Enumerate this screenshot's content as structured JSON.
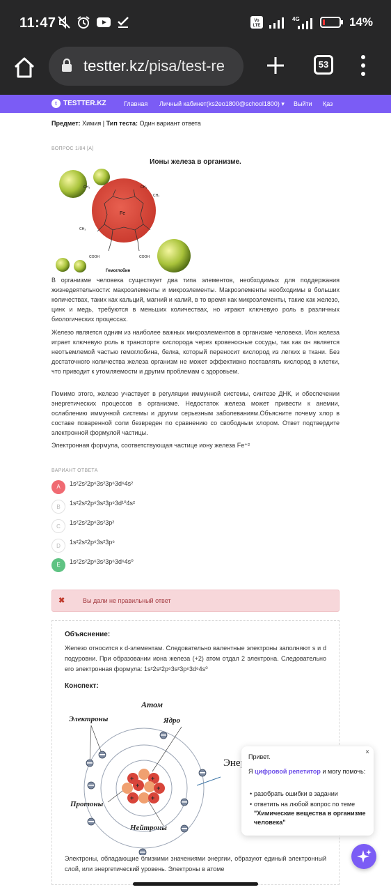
{
  "status_bar": {
    "time": "11:47",
    "battery_percent": "14%",
    "network": "4G",
    "volte": "Vo LTE",
    "icons": [
      "mute-icon",
      "alarm-icon",
      "youtube-icon",
      "check-icon",
      "signal-icon",
      "battery-icon"
    ]
  },
  "browser": {
    "url_host": "testter.kz",
    "url_path": "/pisa/test-re",
    "tab_count": "53"
  },
  "site_nav": {
    "logo": "TESTTER.KZ",
    "logo_badge": "t",
    "items": [
      "Главная",
      "Личный кабинет(ks2eo1800@school1800) ▾",
      "Выйти",
      "Қаз"
    ]
  },
  "meta": {
    "subject_label": "Предмет:",
    "subject_value": "Химия",
    "separator": "|",
    "type_label": "Тип теста:",
    "type_value": "Один вариант ответа"
  },
  "question": {
    "number": "ВОПРОС 1/84 [A]",
    "title": "Ионы железа в организме.",
    "image_caption": "Гемоглобин",
    "paragraphs": [
      "В организме человека существует два типа элементов, необходимых для поддержания жизнедеятельности: макроэлементы и микроэлементы. Макроэлементы необходимы в больших количествах, таких как кальций, магний и калий, в то время как микроэлементы, такие как железо, цинк и медь, требуются в меньших количествах, но играют ключевую роль в различных биологических процессах.",
      "Железо является одним из наиболее важных микроэлементов в организме человека. Ион железа играет ключевую роль в транспорте кислорода через кровеносные сосуды, так как он является неотъемлемой частью гемоглобина, белка, который переносит кислород из легких в ткани. Без достаточного количества железа организм не может эффективно поставлять кислород в клетки, что приводит к утомляемости и другим проблемам с здоровьем.",
      "Помимо этого, железо участвует в регуляции иммунной системы, синтезе ДНК, и обеспечении энергетических процессов в организме. Недостаток железа может привести к анемии, ослаблению иммунной системы и другим серьезным заболеваниям.Объясните почему хлор в составе поваренной соли безвреден по сравнению со свободным хлором. Ответ подтвердите электронной формулой частицы."
    ],
    "prompt": "Электронная формула, соответствующая частице иону железа Fe⁺²"
  },
  "variants": {
    "label": "ВАРИАНТ ОТВЕТА",
    "options": [
      {
        "letter": "A",
        "text": "1s²2s²2p⁶3s²3p⁶3d⁶4s²",
        "state": "wrong"
      },
      {
        "letter": "B",
        "text": "1s²2s²2p⁶3s²3p⁶3d¹⁰4s²",
        "state": "none"
      },
      {
        "letter": "C",
        "text": "1s²2s²2p⁶3s²3p²",
        "state": "none"
      },
      {
        "letter": "D",
        "text": "1s²2s²2p⁶3s²3p⁶",
        "state": "none"
      },
      {
        "letter": "E",
        "text": "1s²2s²2p⁶3s²3p⁶3d⁶4s⁰",
        "state": "correct"
      }
    ]
  },
  "result": {
    "icon": "✖",
    "text": "Вы дали не правильный ответ"
  },
  "explanation": {
    "title": "Объяснение:",
    "text": "Железо относится к d-элементам. Следовательно валентные электроны заполняют s и d подуровни.  При образовании иона железа (+2) атом отдал 2 электрона. Следовательно его электронная формула: 1s²2s²2p⁶3s²3p⁶3d⁶4s⁰",
    "konspekt_title": "Конспект:",
    "atom_labels": {
      "atom": "Атом",
      "electrons": "Электроны",
      "nucleus": "Ядро",
      "protons": "Протоны",
      "neutrons": "Нейтроны",
      "energy_partial": "Энер"
    },
    "bottom_text": "Электроны, обладающие близкими значениями энергии, образуют единый электронный слой, или энергетический уровень. Электроны в атоме"
  },
  "chat": {
    "hello": "Привет.",
    "intro_before": "Я ",
    "intro_link": "цифровой репетитор",
    "intro_after": " и могу помочь:",
    "item1": "разобрать ошибки в задании",
    "item2_prefix": "ответить на любой вопрос по теме",
    "item2_topic": "\"Химические вещества в организме человека\"",
    "close": "×"
  },
  "colors": {
    "chrome_dark": "#272728",
    "site_accent": "#7b5cf5",
    "wrong": "#f06a72",
    "correct": "#5fc383",
    "alert_bg": "#f7d7da"
  }
}
